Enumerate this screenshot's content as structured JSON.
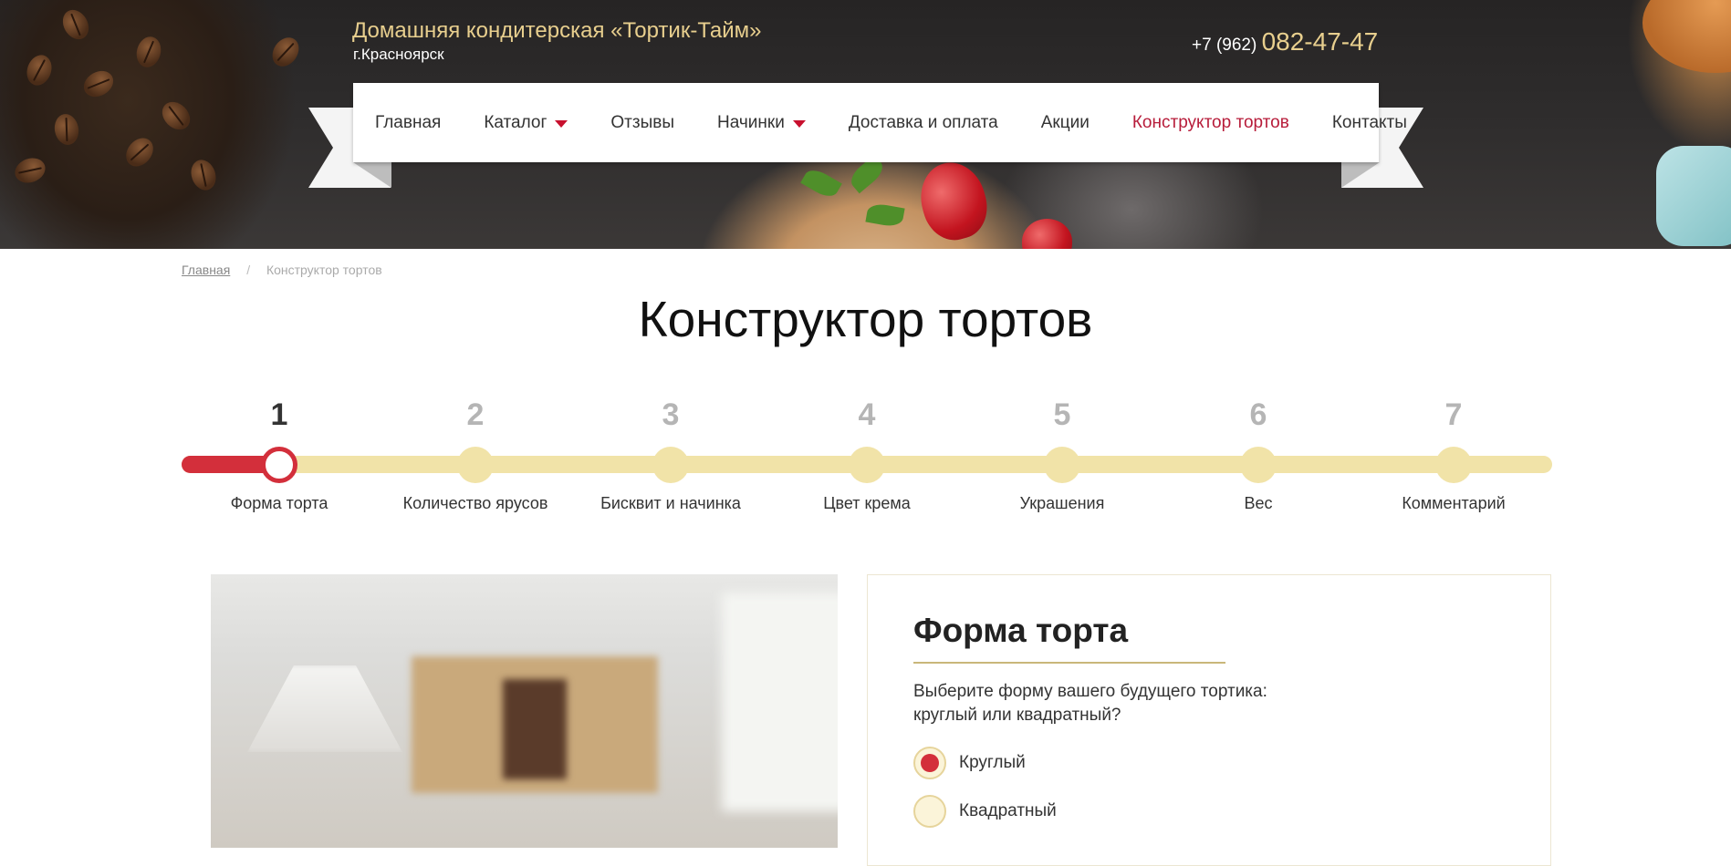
{
  "header": {
    "brand_title": "Домашняя кондитерская «Тортик-Тайм»",
    "city": "г.Красноярск",
    "phone_prefix": "+7 (962)",
    "phone_number": "082-47-47"
  },
  "nav": {
    "items": [
      {
        "label": "Главная",
        "has_dropdown": false,
        "active": false
      },
      {
        "label": "Каталог",
        "has_dropdown": true,
        "active": false
      },
      {
        "label": "Отзывы",
        "has_dropdown": false,
        "active": false
      },
      {
        "label": "Начинки",
        "has_dropdown": true,
        "active": false
      },
      {
        "label": "Доставка и оплата",
        "has_dropdown": false,
        "active": false
      },
      {
        "label": "Акции",
        "has_dropdown": false,
        "active": false
      },
      {
        "label": "Конструктор тортов",
        "has_dropdown": false,
        "active": true
      },
      {
        "label": "Контакты",
        "has_dropdown": false,
        "active": false
      }
    ]
  },
  "breadcrumb": {
    "home": "Главная",
    "separator": "/",
    "current": "Конструктор тортов"
  },
  "page_title": "Конструктор тортов",
  "stepper": {
    "current_step": 1,
    "steps": [
      {
        "num": "1",
        "label": "Форма торта"
      },
      {
        "num": "2",
        "label": "Количество ярусов"
      },
      {
        "num": "3",
        "label": "Бисквит и начинка"
      },
      {
        "num": "4",
        "label": "Цвет крема"
      },
      {
        "num": "5",
        "label": "Украшения"
      },
      {
        "num": "6",
        "label": "Вес"
      },
      {
        "num": "7",
        "label": "Комментарий"
      }
    ]
  },
  "form": {
    "title": "Форма торта",
    "description": "Выберите форму вашего будущего тортика: круглый или квадратный?",
    "options": [
      {
        "label": "Круглый",
        "selected": true
      },
      {
        "label": "Квадратный",
        "selected": false
      }
    ]
  },
  "colors": {
    "accent_red": "#d32f3b",
    "gold_text": "#e8cf8e",
    "track_cream": "#f1e3a8",
    "nav_active": "#b71c3a"
  }
}
